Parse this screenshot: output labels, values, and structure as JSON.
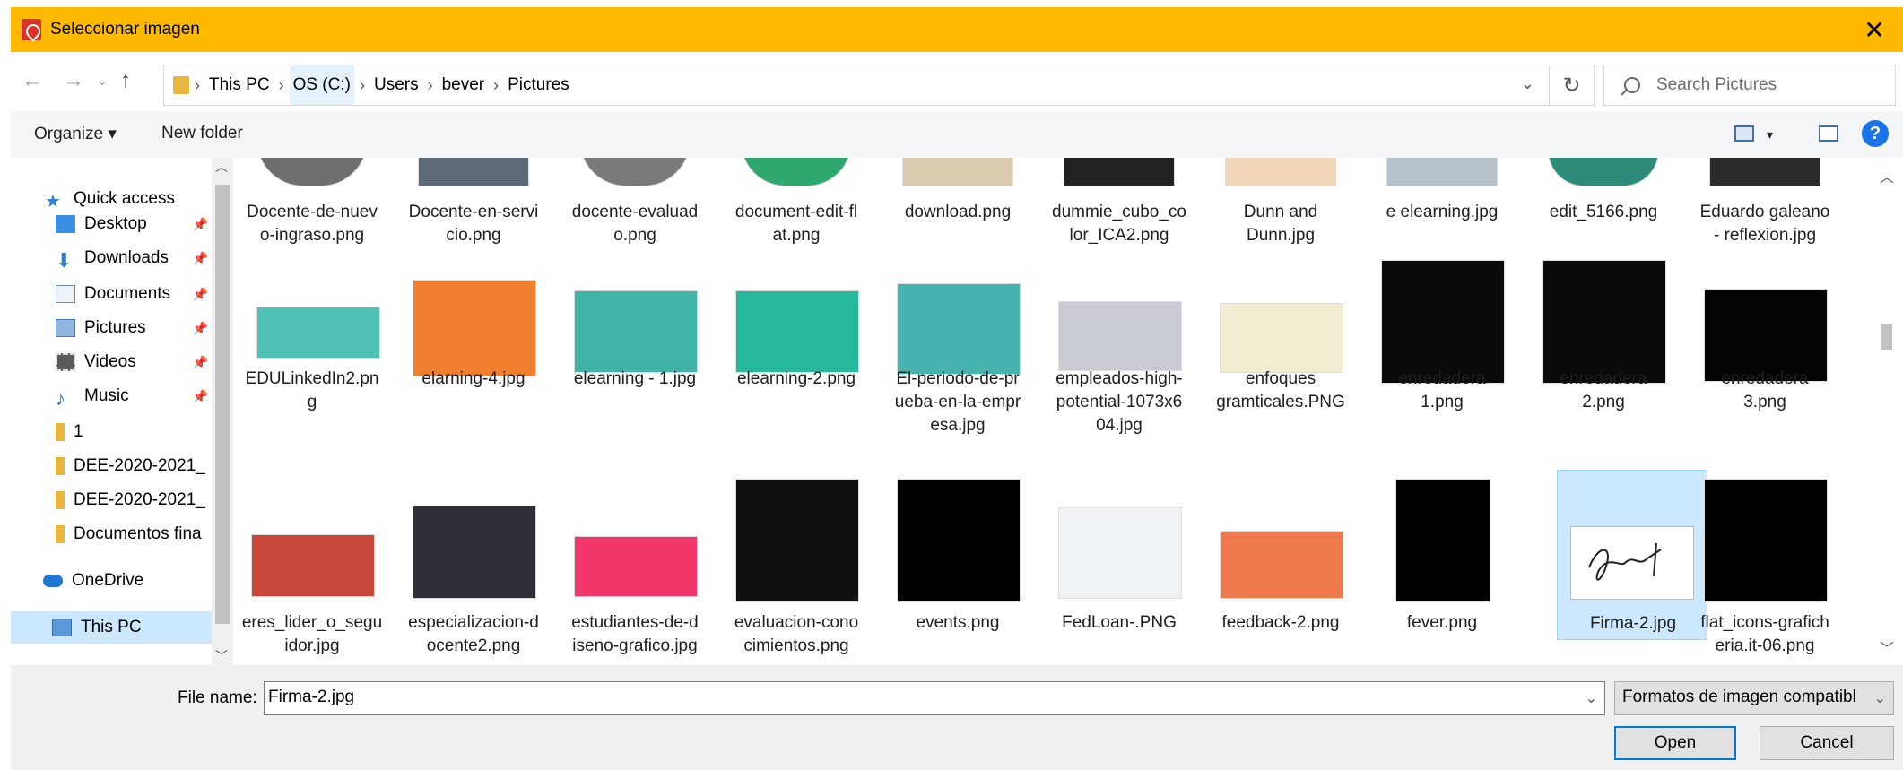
{
  "window": {
    "title": "Seleccionar imagen",
    "close_glyph": "✕"
  },
  "address": {
    "crumbs": [
      "This PC",
      "OS (C:)",
      "Users",
      "bever",
      "Pictures"
    ],
    "search_placeholder": "Search Pictures"
  },
  "toolbar": {
    "organize": "Organize ▾",
    "new_folder": "New folder",
    "help": "?"
  },
  "nav": {
    "items": [
      {
        "label": "Quick access",
        "icon": "star-icon"
      },
      {
        "label": "Desktop",
        "icon": "desktop-icon",
        "pinned": true
      },
      {
        "label": "Downloads",
        "icon": "download-icon",
        "pinned": true
      },
      {
        "label": "Documents",
        "icon": "documents-icon",
        "pinned": true
      },
      {
        "label": "Pictures",
        "icon": "pictures-icon",
        "pinned": true
      },
      {
        "label": "Videos",
        "icon": "videos-icon",
        "pinned": true
      },
      {
        "label": "Music",
        "icon": "music-icon",
        "pinned": true
      },
      {
        "label": "1",
        "icon": "folder-icon"
      },
      {
        "label": "DEE-2020-2021_",
        "icon": "folder-icon"
      },
      {
        "label": "DEE-2020-2021_",
        "icon": "folder-icon"
      },
      {
        "label": "Documentos fina",
        "icon": "folder-icon"
      },
      {
        "label": "OneDrive",
        "icon": "cloud-icon"
      },
      {
        "label": "This PC",
        "icon": "computer-icon",
        "selected": true
      }
    ]
  },
  "files": {
    "row1": [
      {
        "l1": "Docente-de-nuev",
        "l2": "o-ingraso.png",
        "color": "#6e6e6e"
      },
      {
        "l1": "Docente-en-servi",
        "l2": "cio.png",
        "color": "#5f6a78"
      },
      {
        "l1": "docente-evaluad",
        "l2": "o.png",
        "color": "#7a7a7a"
      },
      {
        "l1": "document-edit-fl",
        "l2": "at.png",
        "color": "#2fa86f"
      },
      {
        "l1": "download.png",
        "l2": "",
        "color": "#d8cbb0"
      },
      {
        "l1": "dummie_cubo_co",
        "l2": "lor_ICA2.png",
        "color": "#222222"
      },
      {
        "l1": "Dunn and",
        "l2": "Dunn.jpg",
        "color": "#f2d7b8"
      },
      {
        "l1": "e elearning.jpg",
        "l2": "",
        "color": "#b8c2cc"
      },
      {
        "l1": "edit_5166.png",
        "l2": "",
        "color": "#2e8b7a"
      },
      {
        "l1": "Eduardo galeano",
        "l2": "- reflexion.jpg",
        "color": "#2b2b2b"
      }
    ],
    "row2": [
      {
        "l1": "EDULinkedIn2.pn",
        "l2": "g",
        "l3": "",
        "color": "#4fc1b5"
      },
      {
        "l1": "elarning-4.jpg",
        "l2": "",
        "l3": "",
        "color": "#f07e2c"
      },
      {
        "l1": "elearning - 1.jpg",
        "l2": "",
        "l3": "",
        "color": "#3fb3a6"
      },
      {
        "l1": "elearning-2.png",
        "l2": "",
        "l3": "",
        "color": "#25b89a"
      },
      {
        "l1": "El-periodo-de-pr",
        "l2": "ueba-en-la-empr",
        "l3": "esa.jpg",
        "color": "#47b3b0"
      },
      {
        "l1": "empleados-high-",
        "l2": "potential-1073x6",
        "l3": "04.jpg",
        "color": "#c9cdd3"
      },
      {
        "l1": "enfoques",
        "l2": "gramticales.PNG",
        "l3": "",
        "color": "#f2eed2"
      },
      {
        "l1": "enredadera",
        "l2": "1.png",
        "l3": "",
        "color": "#0a0a0a"
      },
      {
        "l1": "enredadera",
        "l2": "2.png",
        "l3": "",
        "color": "#0a0a0a"
      },
      {
        "l1": "enredadera",
        "l2": "3.png",
        "l3": "",
        "color": "#050505"
      }
    ],
    "row3": [
      {
        "l1": "eres_lider_o_segu",
        "l2": "idor.jpg",
        "color": "#c9473a"
      },
      {
        "l1": "especializacion-d",
        "l2": "ocente2.png",
        "color": "#2f2f3a"
      },
      {
        "l1": "estudiantes-de-d",
        "l2": "iseno-grafico.jpg",
        "color": "#f2386b"
      },
      {
        "l1": "evaluacion-cono",
        "l2": "cimientos.png",
        "color": "#111111"
      },
      {
        "l1": "events.png",
        "l2": "",
        "color": "#e94b45"
      },
      {
        "l1": "FedLoan-.PNG",
        "l2": "",
        "color": "#eef2f5"
      },
      {
        "l1": "feedback-2.png",
        "l2": "",
        "color": "#ee7a4d"
      },
      {
        "l1": "fever.png",
        "l2": "",
        "color": "#000000"
      },
      {
        "l1": "Firma-2.jpg",
        "l2": "",
        "color": "#ffffff",
        "selected": true
      },
      {
        "l1": "flat_icons-grafich",
        "l2": "eria.it-06.png",
        "color": "#41c1ec"
      }
    ]
  },
  "bottom": {
    "file_name_label": "File name:",
    "file_name_value": "Firma-2.jpg",
    "filter": "Formatos de imagen compatibl",
    "open": "Open",
    "cancel": "Cancel"
  }
}
